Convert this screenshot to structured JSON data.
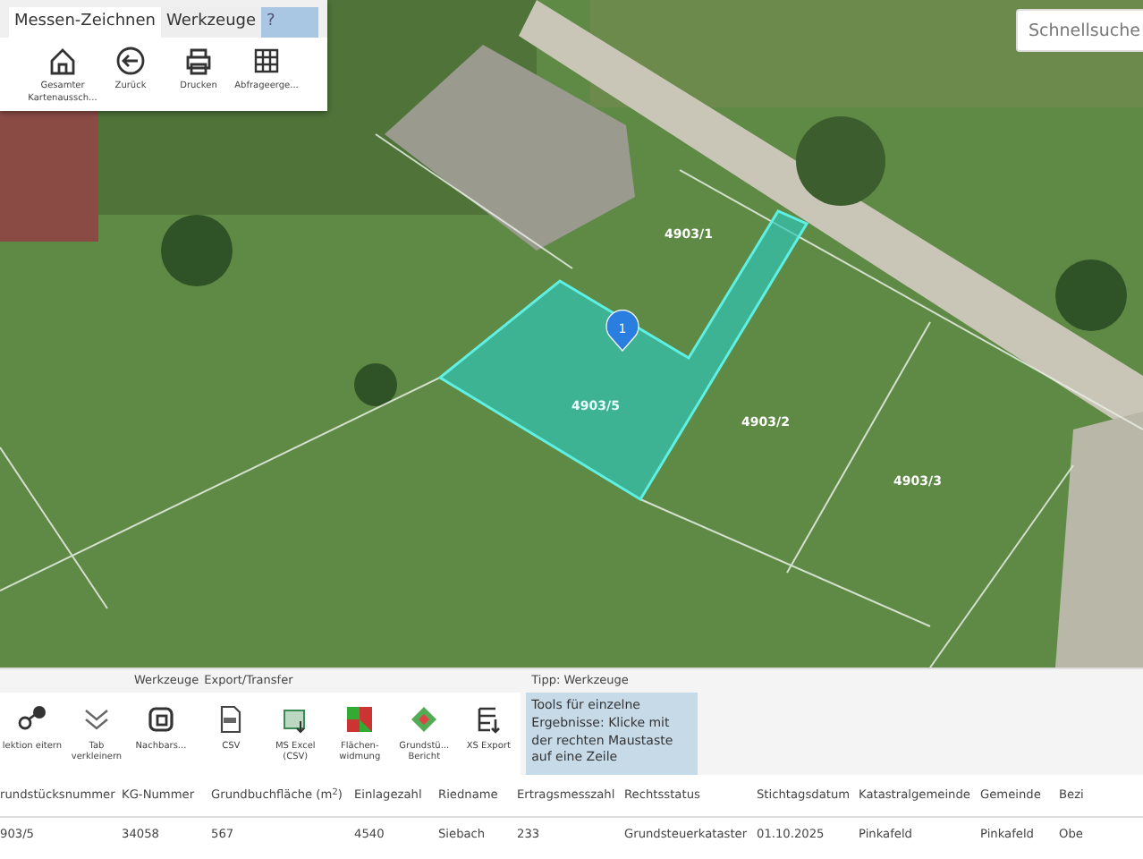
{
  "map": {
    "parcels": [
      {
        "label": "4903/1",
        "selected": false
      },
      {
        "label": "4903/5",
        "selected": true
      },
      {
        "label": "4903/2",
        "selected": false
      },
      {
        "label": "4903/3",
        "selected": false
      }
    ],
    "marker": "1"
  },
  "top_toolbar": {
    "tabs": [
      {
        "label": "Messen-Zeichnen",
        "selected": true
      },
      {
        "label": "Werkzeuge",
        "selected": false
      },
      {
        "label": "?",
        "selected": false
      }
    ],
    "buttons": [
      {
        "kind": "home",
        "label": "Gesamter Kartenaussch..."
      },
      {
        "kind": "back",
        "label": "Zurück"
      },
      {
        "kind": "print",
        "label": "Drucken"
      },
      {
        "kind": "grid",
        "label": "Abfrageerge..."
      }
    ]
  },
  "search": {
    "placeholder": "Schnellsuche"
  },
  "bottom_toolbar": {
    "groups": [
      {
        "buttons": [
          {
            "kind": "select",
            "label": "lektion eitern"
          },
          {
            "kind": "chevrons",
            "label": "Tab verkleinern"
          }
        ]
      },
      {
        "title": "Werkzeuge",
        "buttons": [
          {
            "kind": "frame",
            "label": "Nachbars..."
          }
        ]
      },
      {
        "title": "Export/Transfer",
        "buttons": [
          {
            "kind": "csv",
            "label": "CSV"
          },
          {
            "kind": "excel",
            "label": "MS Excel (CSV)"
          },
          {
            "kind": "zoning",
            "label": "Flächen-widmung"
          },
          {
            "kind": "report",
            "label": "Grundstü... Bericht"
          },
          {
            "kind": "export",
            "label": "XS Export"
          }
        ]
      }
    ],
    "tip": {
      "title": "Tipp: Werkzeuge",
      "text": "Tools für einzelne Ergebnisse: Klicke mit der rechten Maustaste auf eine Zeile"
    }
  },
  "table": {
    "columns": [
      "rundstücksnummer",
      "KG-Nummer",
      "Grundbuchfläche (m$^{2}$)",
      "Einlagezahl",
      "Riedname",
      "Ertragsmesszahl",
      "Rechtsstatus",
      "Stichtagsdatum",
      "Katastralgemeinde",
      "Gemeinde",
      "Bezi"
    ],
    "rows": [
      [
        "903/5",
        "34058",
        "567",
        "4540",
        "Siebach",
        "233",
        "Grundsteuerkataster",
        "01.10.2025",
        "Pinkafeld",
        "Pinkafeld",
        "Obe"
      ]
    ]
  }
}
